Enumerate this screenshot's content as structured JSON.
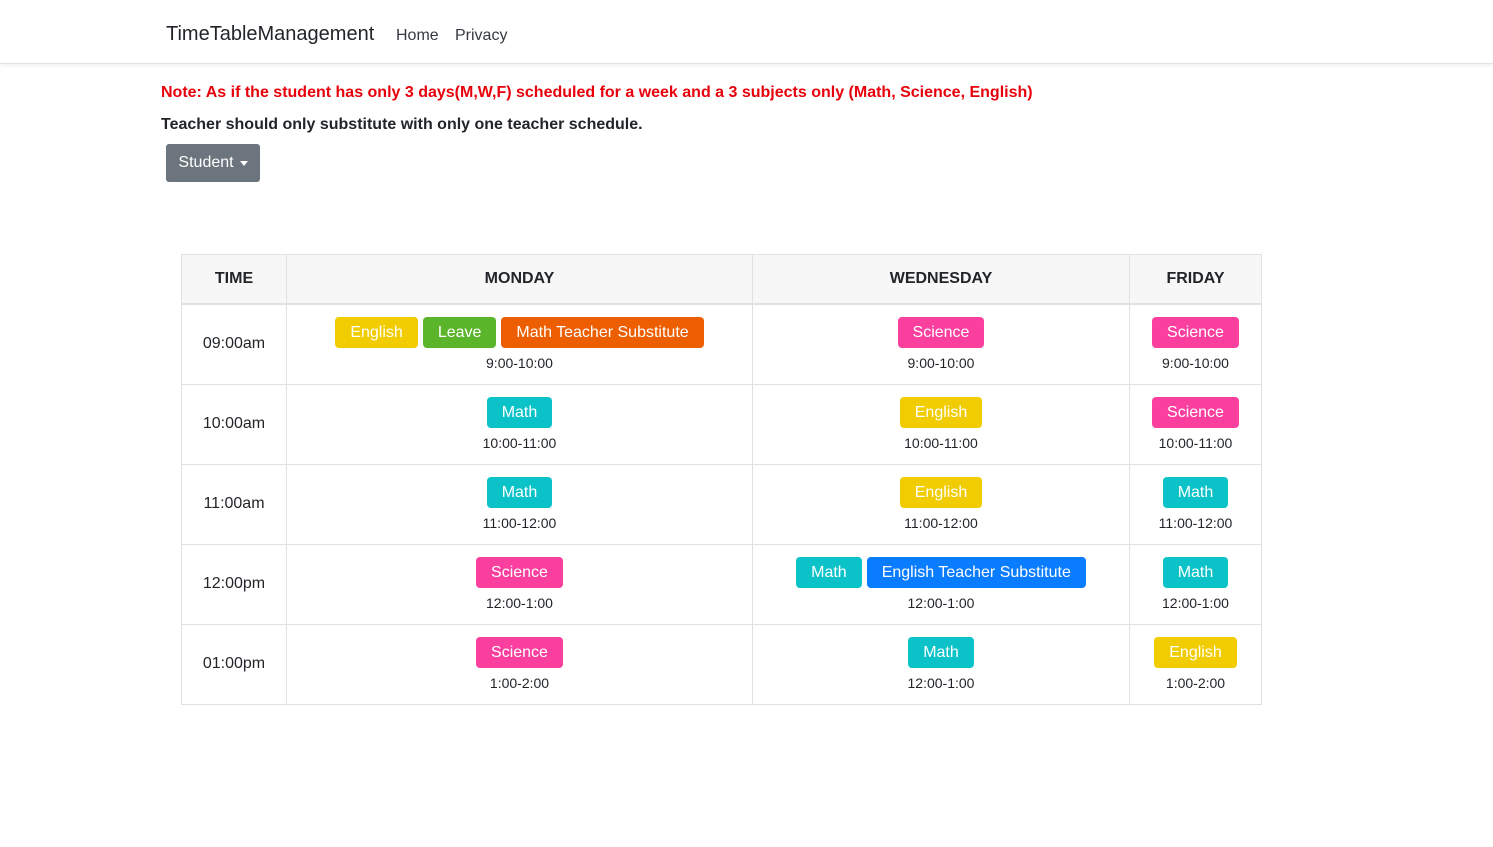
{
  "nav": {
    "brand": "TimeTableManagement",
    "home": "Home",
    "privacy": "Privacy"
  },
  "note": "Note: As if the student has only 3 days(M,W,F) scheduled for a week and a 3 subjects only (Math, Science, English)",
  "subnote": "Teacher should only substitute with only one teacher schedule.",
  "dropdown": {
    "label": "Student"
  },
  "colors": {
    "English": "#f0cc00",
    "Leave": "#5ab52a",
    "Math Teacher Substitute": "#ed5e00",
    "Science": "#fb3f9f",
    "Math": "#0cc2c9",
    "English Teacher Substitute": "#0a7cff"
  },
  "table": {
    "headers": [
      "TIME",
      "MONDAY",
      "WEDNESDAY",
      "FRIDAY"
    ],
    "rows": [
      {
        "time": "09:00am",
        "cells": [
          {
            "badges": [
              "English",
              "Leave",
              "Math Teacher Substitute"
            ],
            "range": "9:00-10:00"
          },
          {
            "badges": [
              "Science"
            ],
            "range": "9:00-10:00"
          },
          {
            "badges": [
              "Science"
            ],
            "range": "9:00-10:00"
          }
        ]
      },
      {
        "time": "10:00am",
        "cells": [
          {
            "badges": [
              "Math"
            ],
            "range": "10:00-11:00"
          },
          {
            "badges": [
              "English"
            ],
            "range": "10:00-11:00"
          },
          {
            "badges": [
              "Science"
            ],
            "range": "10:00-11:00"
          }
        ]
      },
      {
        "time": "11:00am",
        "cells": [
          {
            "badges": [
              "Math"
            ],
            "range": "11:00-12:00"
          },
          {
            "badges": [
              "English"
            ],
            "range": "11:00-12:00"
          },
          {
            "badges": [
              "Math"
            ],
            "range": "11:00-12:00"
          }
        ]
      },
      {
        "time": "12:00pm",
        "cells": [
          {
            "badges": [
              "Science"
            ],
            "range": "12:00-1:00"
          },
          {
            "badges": [
              "Math",
              "English Teacher Substitute"
            ],
            "range": "12:00-1:00"
          },
          {
            "badges": [
              "Math"
            ],
            "range": "12:00-1:00"
          }
        ]
      },
      {
        "time": "01:00pm",
        "cells": [
          {
            "badges": [
              "Science"
            ],
            "range": "1:00-2:00"
          },
          {
            "badges": [
              "Math"
            ],
            "range": "12:00-1:00"
          },
          {
            "badges": [
              "English"
            ],
            "range": "1:00-2:00"
          }
        ]
      }
    ]
  }
}
